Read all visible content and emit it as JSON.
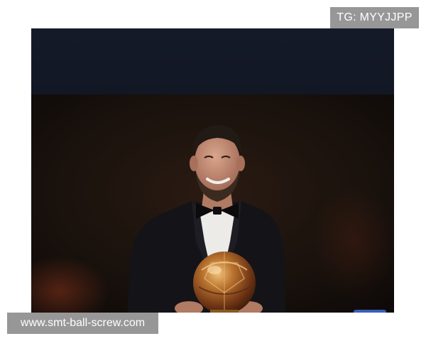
{
  "watermarks": {
    "top_right": "TG: MYYJJPP",
    "bottom_left": "www.smt-ball-screw.com"
  },
  "colors": {
    "top_band": "#151b2a",
    "backdrop": "#130e0b",
    "tuxedo": "#131316",
    "shirt": "#ecebe8",
    "skin": "#c9917a",
    "hair": "#201812",
    "trophy_gold": "#b5742f",
    "badge_bg": "#8c8c8c",
    "badge_text": "#ffffff"
  }
}
